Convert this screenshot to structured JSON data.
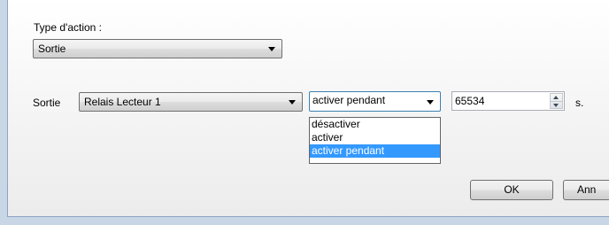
{
  "action_type": {
    "label": "Type d'action :",
    "selected": "Sortie"
  },
  "output_row": {
    "label": "Sortie",
    "relay_selected": "Relais Lecteur 1",
    "mode_selected": "activer pendant",
    "mode_options": [
      "désactiver",
      "activer",
      "activer pendant"
    ],
    "duration_value": "65534",
    "unit": "s."
  },
  "buttons": {
    "ok": "OK",
    "cancel": "Ann"
  },
  "colors": {
    "selection": "#3399ff",
    "focus_border": "#3c7fb1",
    "frame": "#c9d6e6"
  }
}
